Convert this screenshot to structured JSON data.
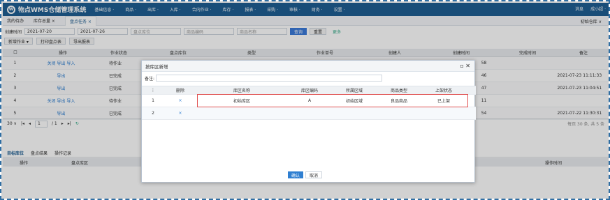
{
  "app": {
    "title": "物点WMS仓储管理系统",
    "logo": "W",
    "menu": [
      "基础信息 ·",
      "商品 ·",
      "出库 ·",
      "入库 ·",
      "合内作业 ·",
      "库存 ·",
      "报表 ·",
      "采购 ·",
      "审核 ·",
      "财务 ·",
      "设置 ·"
    ],
    "right": [
      "消息",
      "成小超 ·"
    ]
  },
  "tabs": [
    "我的待办",
    "库存总量 ×",
    "盘点任务 ×"
  ],
  "warehouse": "初始仓库 ∨",
  "search": {
    "label": "创建时间",
    "date_from": "2021-07-20",
    "date_to": "2021-07-26",
    "placeholders": [
      "盘点库位",
      "商品编码",
      "商品名称"
    ],
    "query": "查询",
    "reset": "重置",
    "more": "更多"
  },
  "toolbar": [
    "新增作业 ▾",
    "打印盘点表",
    "导出报表"
  ],
  "grid": {
    "headers": [
      "操作",
      "作业状态",
      "盘点库位",
      "类型",
      "作业单号",
      "创建人",
      "创建时间",
      "完成时间",
      "备注"
    ],
    "rows": [
      {
        "n": "1",
        "op": "关闭 导出 导入",
        "status": "待作业",
        "ct": "58",
        "done": ""
      },
      {
        "n": "2",
        "op": "导出",
        "status": "已完成",
        "ct": "46",
        "done": "2021-07-23 11:11:33"
      },
      {
        "n": "3",
        "op": "导出",
        "status": "已完成",
        "ct": "47",
        "done": "2021-07-23 11:04:51"
      },
      {
        "n": "4",
        "op": "关闭 导出 导入",
        "status": "待作业",
        "ct": "11",
        "done": ""
      },
      {
        "n": "5",
        "op": "导出",
        "status": "已完成",
        "ct": "54",
        "done": "2021-07-22 11:30:31"
      }
    ]
  },
  "pager": {
    "size": "30 ∨",
    "page": "1",
    "total": "/ 1",
    "right": "每页 30 条, 共 5 条"
  },
  "bottomtabs": [
    "目标库位",
    "盘点结果",
    "操作记录"
  ],
  "bottomhead": [
    "操作",
    "盘点库区",
    "操作时间"
  ],
  "dialog": {
    "title": "按库区新增",
    "note_label": "备注:",
    "headers": [
      "",
      "删除",
      "库区名称",
      "库区编码",
      "所属区域",
      "商品类型",
      "上架状态"
    ],
    "rows": [
      {
        "n": "1",
        "del": "×",
        "name": "初始库区",
        "code": "A",
        "area": "初始区域",
        "type": "良品商品",
        "state": "已上架"
      },
      {
        "n": "2",
        "del": "×",
        "name": "",
        "code": "",
        "area": "",
        "type": "",
        "state": ""
      }
    ],
    "ok": "确认",
    "cancel": "取消"
  }
}
